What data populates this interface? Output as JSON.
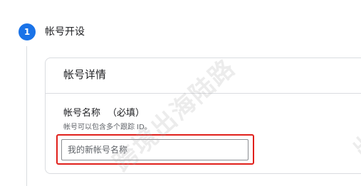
{
  "step": {
    "number": "1",
    "title": "帐号开设"
  },
  "card": {
    "title": "帐号详情"
  },
  "account_name_field": {
    "label": "帐号名称",
    "required_hint": "（必填）",
    "help_text": "帐号可以包含多个跟踪 ID。",
    "value": "",
    "placeholder": "我的新帐号名称"
  },
  "watermark": {
    "main": "跨境出海陆路",
    "edge": "出"
  },
  "colors": {
    "accent": "#1a73e8",
    "highlight": "#e0201b",
    "border": "#dadce0"
  }
}
